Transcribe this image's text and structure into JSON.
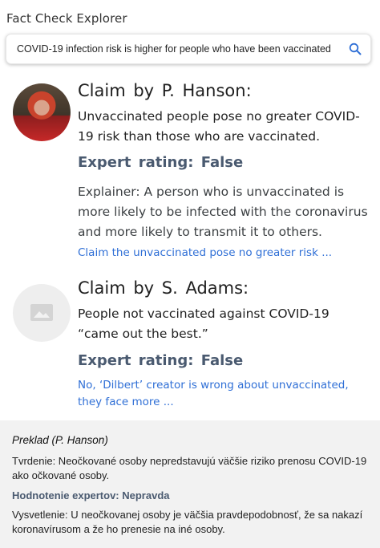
{
  "app": {
    "title": "Fact Check Explorer"
  },
  "search": {
    "value": "COVID-19 infection risk is higher for people who have been vaccinated",
    "icon": "search-icon"
  },
  "claims": [
    {
      "title": "Claim  by  P.  Hanson:",
      "text": "Unvaccinated people pose no greater COVID-19 risk than those who are vaccinated.",
      "rating": "Expert  rating:  False",
      "explainer": "Explainer:  A person who is unvaccinated is more likely to be infected with the coronavirus and more likely to transmit it to others.",
      "link": "Claim the unvaccinated pose no greater risk ..."
    },
    {
      "title": "Claim  by  S.  Adams:",
      "text": "People not vaccinated against COVID-19 “came out the best.”",
      "rating": "Expert  rating:  False",
      "link": "No, ‘Dilbert’ creator is wrong about unvaccinated, they face more ..."
    }
  ],
  "translation": {
    "heading": "Preklad (P. Hanson)",
    "claim": "Tvrdenie: Neočkované osoby nepredstavujú väčšie riziko prenosu COVID-19 ako očkované osoby.",
    "rating": "Hodnotenie expertov: Nepravda",
    "explainer": "Vysvetlenie: U neočkovanej osoby je väčšia pravdepodobnosť, že sa nakazí koronavírusom a že ho prenesie na iné osoby."
  },
  "colors": {
    "link": "#2f6fd6",
    "rating": "#4a5a70",
    "panel": "#f2f2f2"
  }
}
